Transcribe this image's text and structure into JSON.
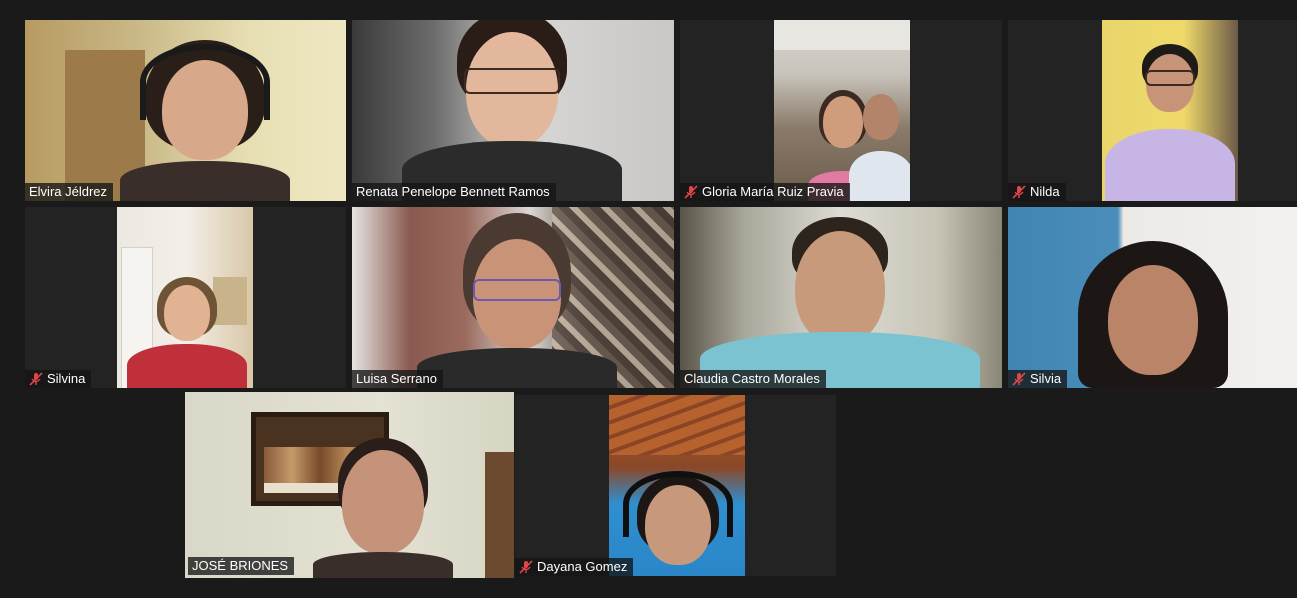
{
  "participants": [
    {
      "name": "Elvira Jéldrez",
      "muted": false
    },
    {
      "name": "Renata Penelope Bennett Ramos",
      "muted": false
    },
    {
      "name": "Gloria María Ruiz Pravia",
      "muted": true
    },
    {
      "name": "Nilda",
      "muted": true
    },
    {
      "name": "Silvina",
      "muted": true
    },
    {
      "name": "Luisa Serrano",
      "muted": false
    },
    {
      "name": "Claudia Castro Morales",
      "muted": false
    },
    {
      "name": "Silvia",
      "muted": true
    },
    {
      "name": "JOSÉ BRIONES",
      "muted": false,
      "active_speaker": true
    },
    {
      "name": "Dayana Gomez",
      "muted": true
    }
  ],
  "colors": {
    "background": "#1a1a1a",
    "tile": "#232323",
    "active_border": "#a9d04a",
    "muted_icon": "#e0454a",
    "label_text": "#ffffff"
  },
  "icons": {
    "muted": "mic-muted-icon"
  }
}
